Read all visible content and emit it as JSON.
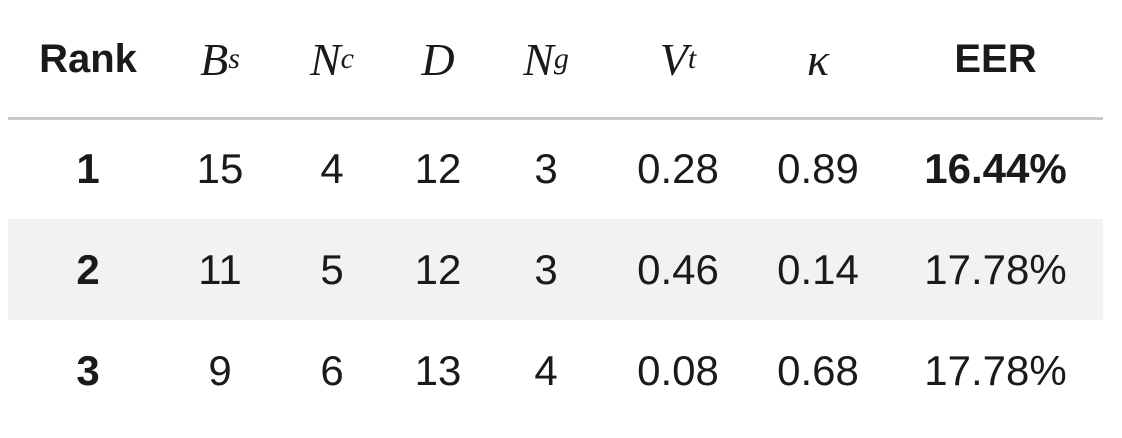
{
  "table": {
    "headers": [
      {
        "type": "text",
        "label": "Rank"
      },
      {
        "type": "math",
        "base": "B",
        "sub": "s"
      },
      {
        "type": "math",
        "base": "N",
        "sub": "c"
      },
      {
        "type": "math",
        "base": "D",
        "sub": ""
      },
      {
        "type": "math",
        "base": "N",
        "sub": "g"
      },
      {
        "type": "math",
        "base": "V",
        "sub": "t"
      },
      {
        "type": "math",
        "base": "κ",
        "sub": ""
      },
      {
        "type": "text",
        "label": "EER"
      }
    ],
    "rows": [
      {
        "rank": "1",
        "bs": "15",
        "nc": "4",
        "d": "12",
        "ng": "3",
        "vt": "0.28",
        "kappa": "0.89",
        "eer": "16.44%",
        "eer_bold": true
      },
      {
        "rank": "2",
        "bs": "11",
        "nc": "5",
        "d": "12",
        "ng": "3",
        "vt": "0.46",
        "kappa": "0.14",
        "eer": "17.78%",
        "eer_bold": false
      },
      {
        "rank": "3",
        "bs": "9",
        "nc": "6",
        "d": "13",
        "ng": "4",
        "vt": "0.08",
        "kappa": "0.68",
        "eer": "17.78%",
        "eer_bold": false
      }
    ]
  }
}
